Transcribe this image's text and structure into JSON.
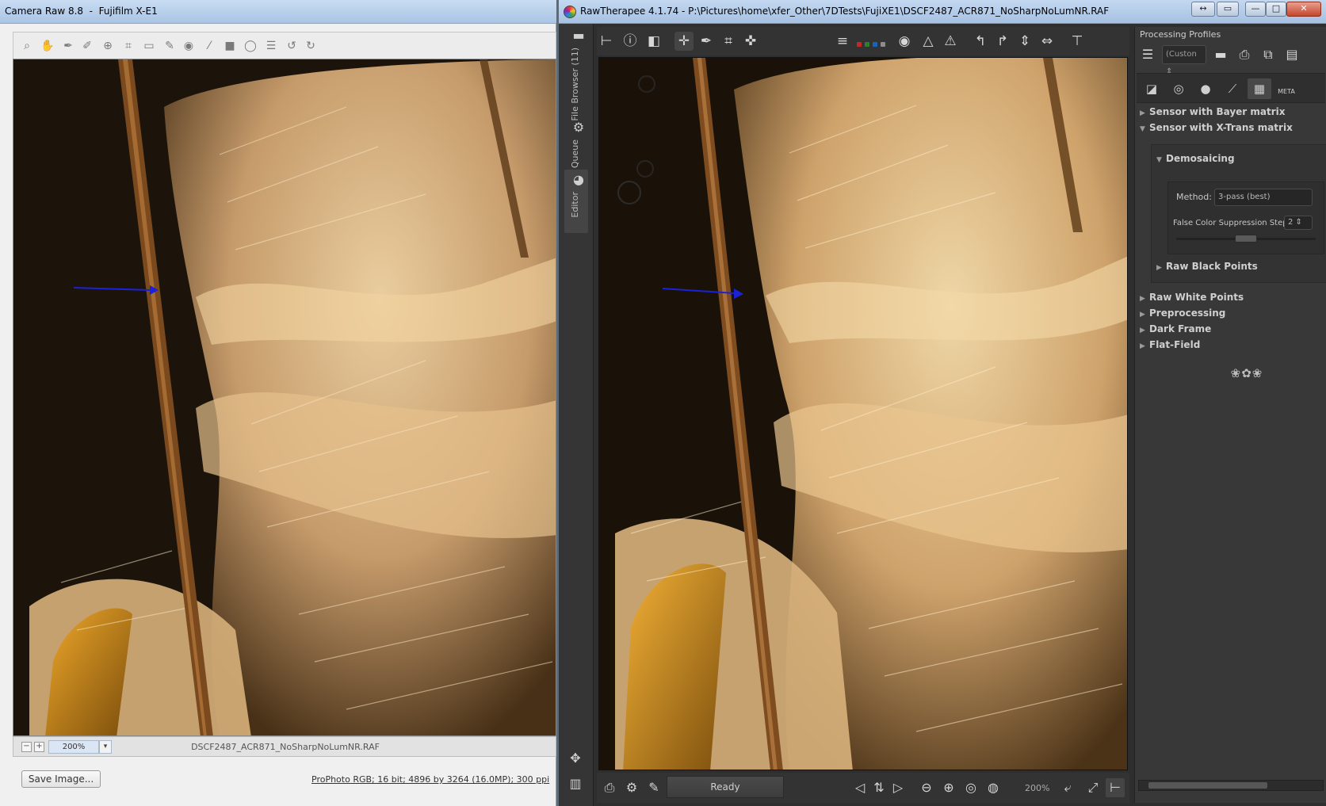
{
  "acr": {
    "window_title": "Camera Raw 8.8  -  Fujifilm X-E1",
    "zoom": "200%",
    "filename": "DSCF2487_ACR871_NoSharpNoLumNR.RAF",
    "save_button": "Save Image...",
    "workflow_info": "ProPhoto RGB; 16 bit; 4896 by 3264 (16.0MP); 300 ppi",
    "tools": [
      "zoom-icon",
      "hand-icon",
      "white-balance-icon",
      "color-sampler-icon",
      "target-adjust-icon",
      "crop-icon",
      "straighten-icon",
      "spot-removal-icon",
      "red-eye-icon",
      "adjustment-brush-icon",
      "graduated-filter-icon",
      "radial-filter-icon",
      "preferences-icon",
      "rotate-left-icon",
      "rotate-right-icon"
    ],
    "zoom_buttons": {
      "minus": "−",
      "plus": "+",
      "dropdown": "▾"
    }
  },
  "rt": {
    "window_title": "RawTherapee 4.1.74 - P:\\Pictures\\home\\xfer_Other\\7DTests\\FujiXE1\\DSCF2487_ACR871_NoSharpNoLumNR.RAF",
    "side_tabs": {
      "file_browser": "File Browser (11)",
      "queue": "Queue",
      "editor": "Editor"
    },
    "status": "Ready",
    "zoom": "200%",
    "processing_profiles_label": "Processing Profiles",
    "profile_value": "(Custon",
    "sections": {
      "bayer": "Sensor with Bayer matrix",
      "xtrans": "Sensor with X-Trans matrix",
      "demosaicing": "Demosaicing",
      "method_label": "Method:",
      "method_value": "3-pass (best)",
      "fcs_label": "False Color Suppression Steps",
      "fcs_value": "2",
      "raw_black_points": "Raw Black Points",
      "raw_white_points": "Raw White Points",
      "preprocessing": "Preprocessing",
      "dark_frame": "Dark Frame",
      "flat_field": "Flat-Field"
    },
    "meta_tab": "META",
    "colors": {
      "accent_blue": "#1a22d8"
    }
  }
}
